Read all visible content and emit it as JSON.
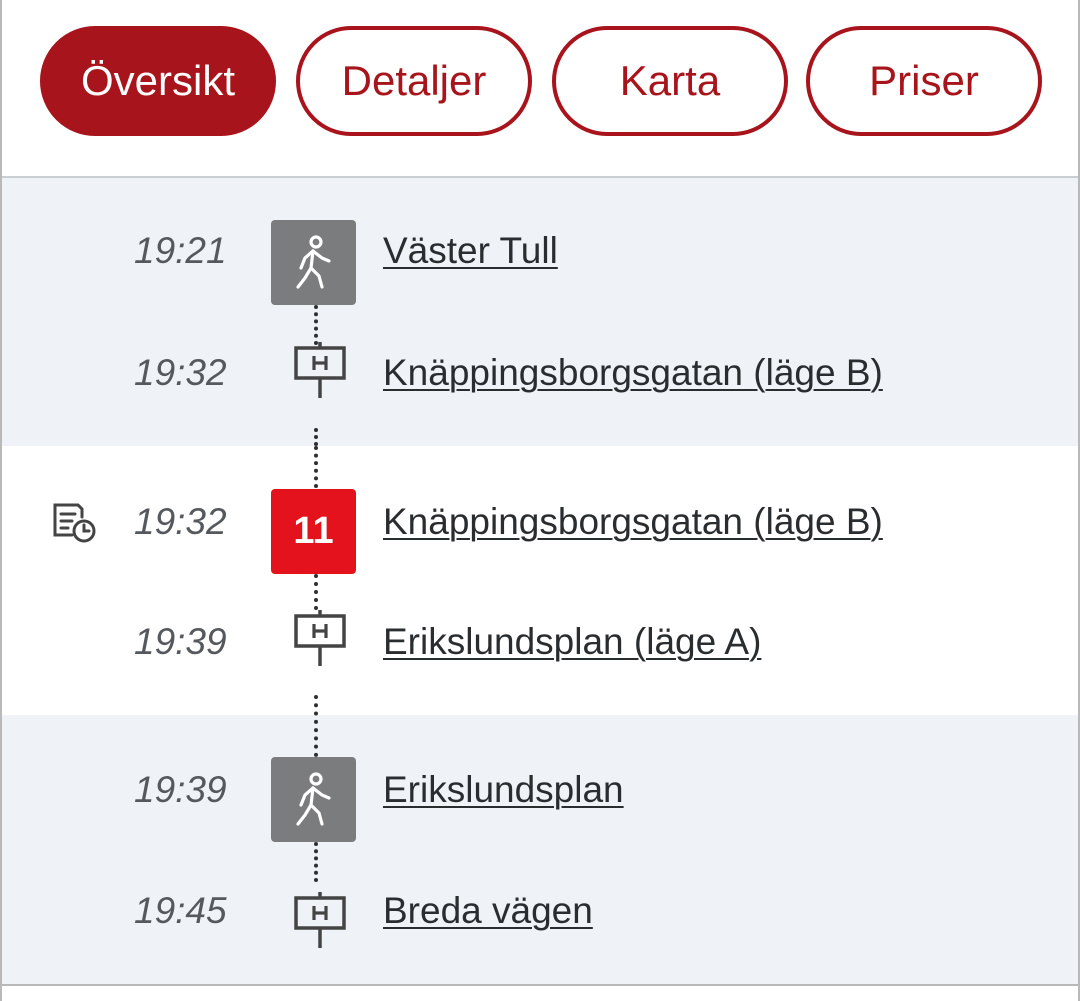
{
  "tabs": [
    {
      "label": "Översikt",
      "active": true
    },
    {
      "label": "Detaljer",
      "active": false
    },
    {
      "label": "Karta",
      "active": false
    },
    {
      "label": "Priser",
      "active": false
    }
  ],
  "legs": [
    {
      "mode": "walk",
      "mode_icon": "walking-person-icon",
      "from": {
        "time": "19:21",
        "stop": "Väster Tull"
      },
      "to": {
        "time": "19:32",
        "stop": "Knäppingsborgsgatan (läge B)",
        "icon": "bus-stop-icon"
      }
    },
    {
      "mode": "bus",
      "line": "11",
      "line_color": "#e3121c",
      "info_icon": "timetable-clock-icon",
      "from": {
        "time": "19:32",
        "stop": "Knäppingsborgsgatan (läge B)"
      },
      "to": {
        "time": "19:39",
        "stop": "Erikslundsplan (läge A)",
        "icon": "bus-stop-icon"
      }
    },
    {
      "mode": "walk",
      "mode_icon": "walking-person-icon",
      "from": {
        "time": "19:39",
        "stop": "Erikslundsplan"
      },
      "to": {
        "time": "19:45",
        "stop": "Breda vägen",
        "icon": "bus-stop-icon"
      }
    }
  ],
  "colors": {
    "accent": "#a8141c",
    "bus_line": "#e3121c",
    "walk_tile": "#7b7c7d",
    "shaded_bg": "#eff3f7"
  }
}
